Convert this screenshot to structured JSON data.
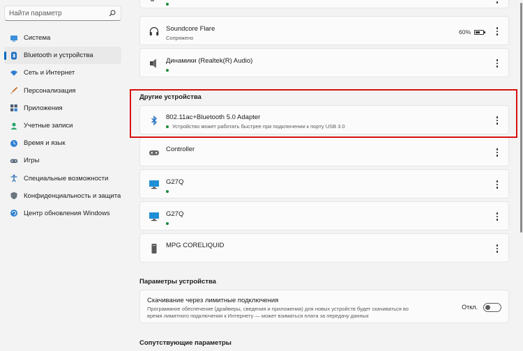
{
  "search": {
    "placeholder": "Найти параметр",
    "icon": "search-icon"
  },
  "nav": [
    {
      "label": "Система",
      "icon": "system-icon",
      "active": false
    },
    {
      "label": "Bluetooth и устройства",
      "icon": "bluetooth-icon",
      "active": true
    },
    {
      "label": "Сеть и Интернет",
      "icon": "network-icon",
      "active": false
    },
    {
      "label": "Персонализация",
      "icon": "brush-icon",
      "active": false
    },
    {
      "label": "Приложения",
      "icon": "apps-icon",
      "active": false
    },
    {
      "label": "Учетные записи",
      "icon": "accounts-icon",
      "active": false
    },
    {
      "label": "Время и язык",
      "icon": "time-language-icon",
      "active": false
    },
    {
      "label": "Игры",
      "icon": "gaming-icon",
      "active": false
    },
    {
      "label": "Специальные возможности",
      "icon": "accessibility-icon",
      "active": false
    },
    {
      "label": "Конфиденциальность и защита",
      "icon": "privacy-shield-icon",
      "active": false
    },
    {
      "label": "Центр обновления Windows",
      "icon": "windows-update-icon",
      "active": false
    }
  ],
  "audio_devices": [
    {
      "name": "Soundcore Flare",
      "status": "Сопряжено",
      "icon": "headphones-icon",
      "battery": "60%",
      "battery_level": 0.6
    },
    {
      "name": "Динамики (Realtek(R) Audio)",
      "icon": "speaker-icon"
    }
  ],
  "other_devices": {
    "title": "Другие устройства",
    "items": [
      {
        "name": "802.11ac+Bluetooth 5.0 Adapter",
        "status": "Устройство может работать быстрее при подключении к порту USB 3.0",
        "icon": "bluetooth-icon"
      },
      {
        "name": "Controller",
        "icon": "gamepad-icon"
      },
      {
        "name": "G27Q",
        "icon": "monitor-icon"
      },
      {
        "name": "G27Q",
        "icon": "monitor-icon"
      },
      {
        "name": "MPG CORELIQUID",
        "icon": "pc-tower-icon"
      }
    ]
  },
  "device_settings": {
    "title": "Параметры устройства",
    "metered": {
      "title": "Скачивание через лимитные подключения",
      "desc_line1": "Программное обеспечение (драйверы, сведения и приложения) для новых устройств будет скачиваться во",
      "desc_line2": "время лимитного подключения к Интернету — может взиматься плата за передачу данных",
      "toggle_label": "Откл.",
      "toggle_on": false
    }
  },
  "related": {
    "title": "Сопутствующие параметры"
  },
  "colors": {
    "accent": "#0067c0",
    "status_dot": "#1b8a3c",
    "highlight": "#d90f0f"
  }
}
